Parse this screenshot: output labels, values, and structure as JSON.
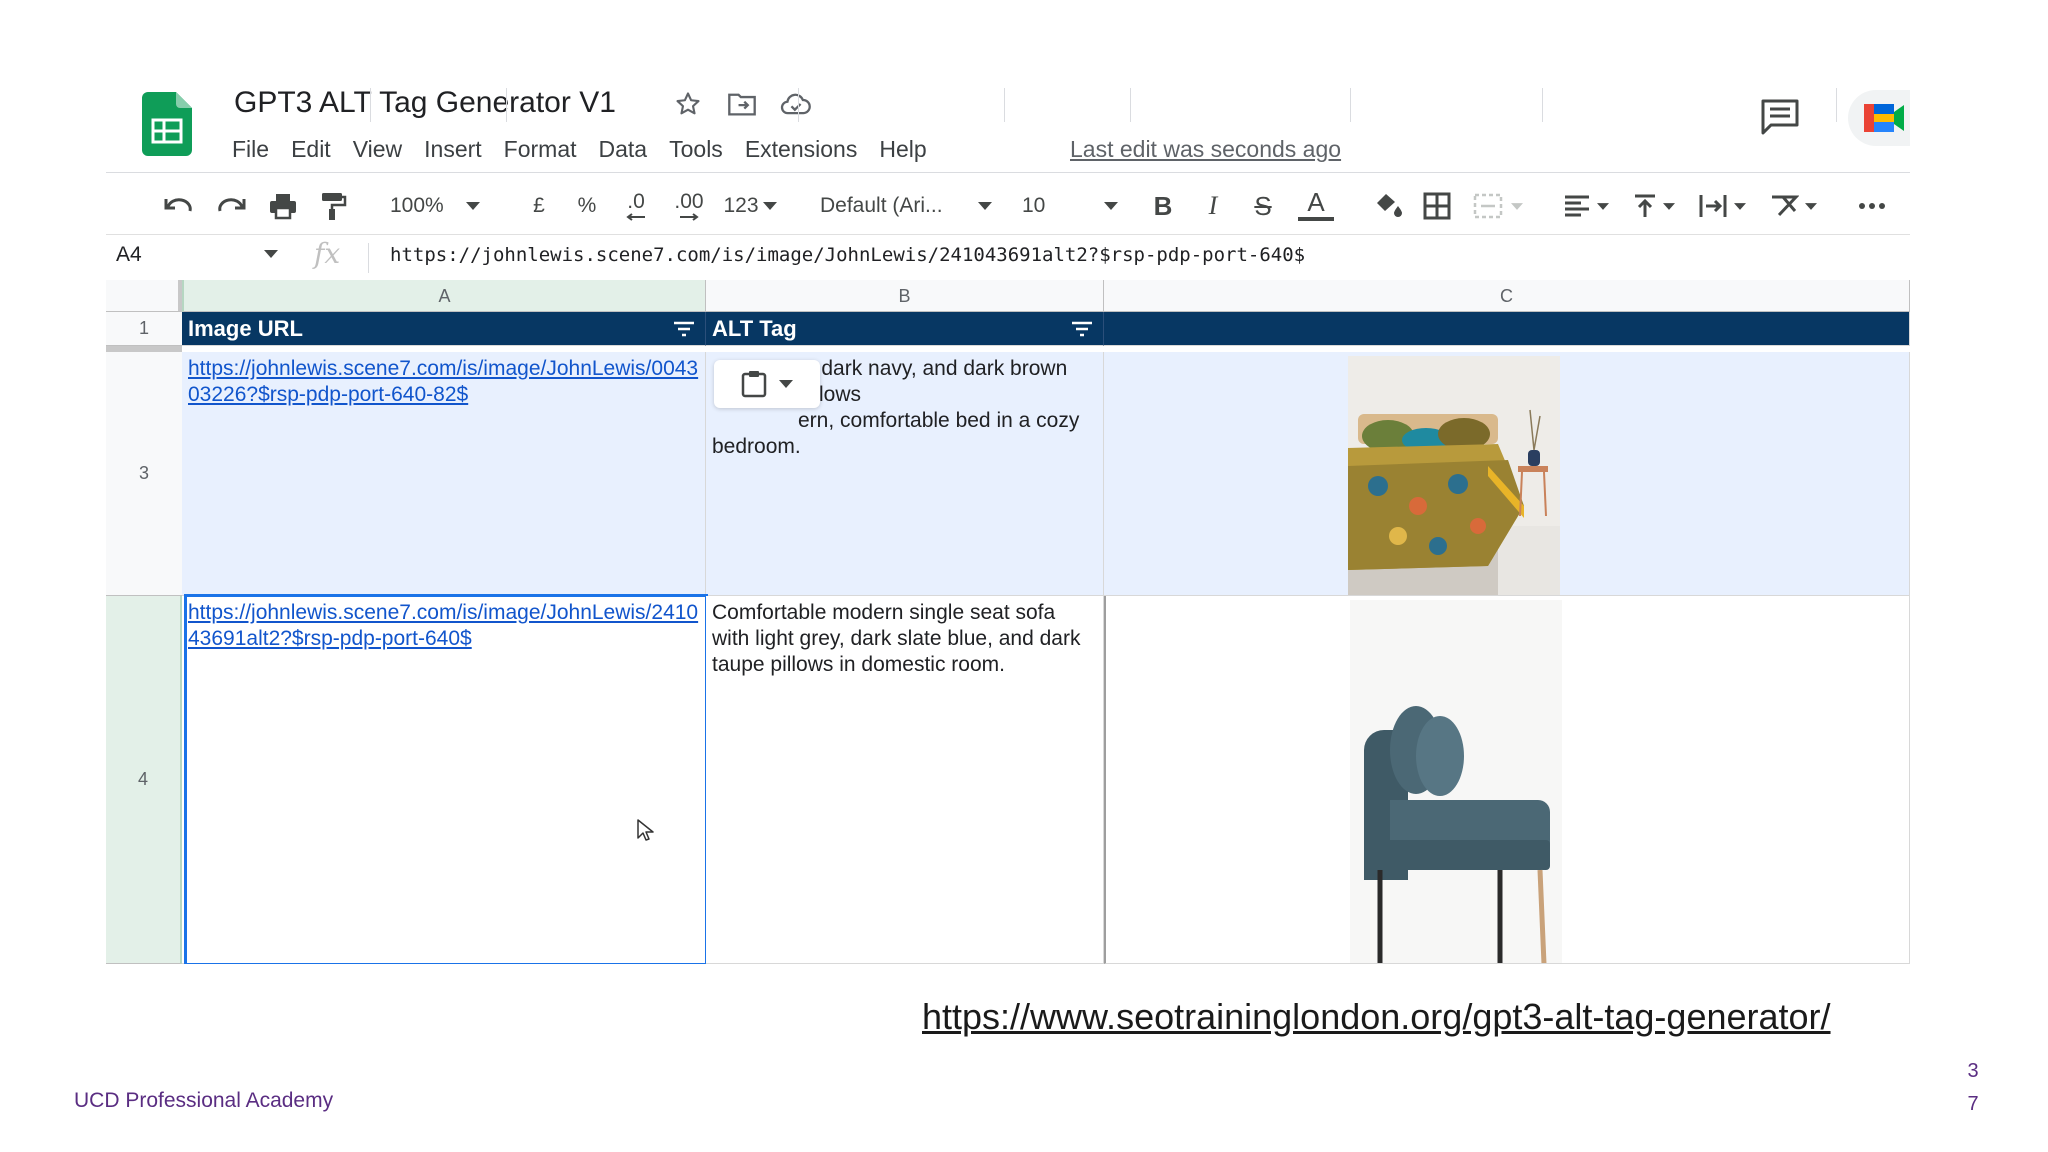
{
  "doc": {
    "title": "GPT3 ALT Tag Generator V1",
    "last_edit": "Last edit was seconds ago"
  },
  "menu": [
    "File",
    "Edit",
    "View",
    "Insert",
    "Format",
    "Data",
    "Tools",
    "Extensions",
    "Help"
  ],
  "toolbar": {
    "zoom": "100%",
    "currency": "£",
    "percent": "%",
    "dec_decrease": ".0",
    "dec_increase": ".00",
    "more_formats": "123",
    "font": "Default (Ari...",
    "font_size": "10",
    "bold": "B",
    "italic": "I",
    "strike": "S",
    "text_color": "A"
  },
  "formula_bar": {
    "cell_ref": "A4",
    "fx": "fx",
    "value": "https://johnlewis.scene7.com/is/image/JohnLewis/241043691alt2?$rsp-pdp-port-640$"
  },
  "columns": [
    "A",
    "B",
    "C"
  ],
  "rows": [
    {
      "num": "1"
    },
    {
      "num": "3"
    },
    {
      "num": "4"
    }
  ],
  "header": {
    "a": "Image URL",
    "b": "ALT Tag"
  },
  "cells": {
    "a3": "https://johnlewis.scene7.com/is/image/JohnLewis/004303226?$rsp-pdp-port-640-82$",
    "b3_l1": "e, dark navy, and dark brown pillows",
    "b3_l2": "ern, comfortable bed in a cozy",
    "b3_l3": "bedroom.",
    "a4": "https://johnlewis.scene7.com/is/image/JohnLewis/241043691alt2?$rsp-pdp-port-640$",
    "b4": "Comfortable modern single seat sofa with light grey, dark slate blue, and dark taupe pillows in domestic room."
  },
  "slide": {
    "link": "https://www.seotraininglondon.org/gpt3-alt-tag-generator/",
    "brand": "UCD Professional Academy",
    "page_digits": [
      "3",
      "7"
    ]
  },
  "colors": {
    "header_bg": "#073763",
    "link": "#1155cc",
    "selection": "#1a73e8",
    "row_selected": "#e8f0fe",
    "brand": "#5a2d82",
    "sheets_green": "#0f9d58"
  },
  "icons": [
    "sheets-logo-icon",
    "star-icon",
    "move-folder-icon",
    "cloud-status-icon",
    "comment-icon",
    "meet-icon",
    "undo-icon",
    "redo-icon",
    "print-icon",
    "paint-format-icon",
    "fill-color-icon",
    "borders-icon",
    "merge-cells-icon",
    "align-left-icon",
    "valign-top-icon",
    "text-wrap-icon",
    "text-rotate-icon",
    "more-icon",
    "filter-icon",
    "clipboard-icon",
    "cursor-icon"
  ]
}
